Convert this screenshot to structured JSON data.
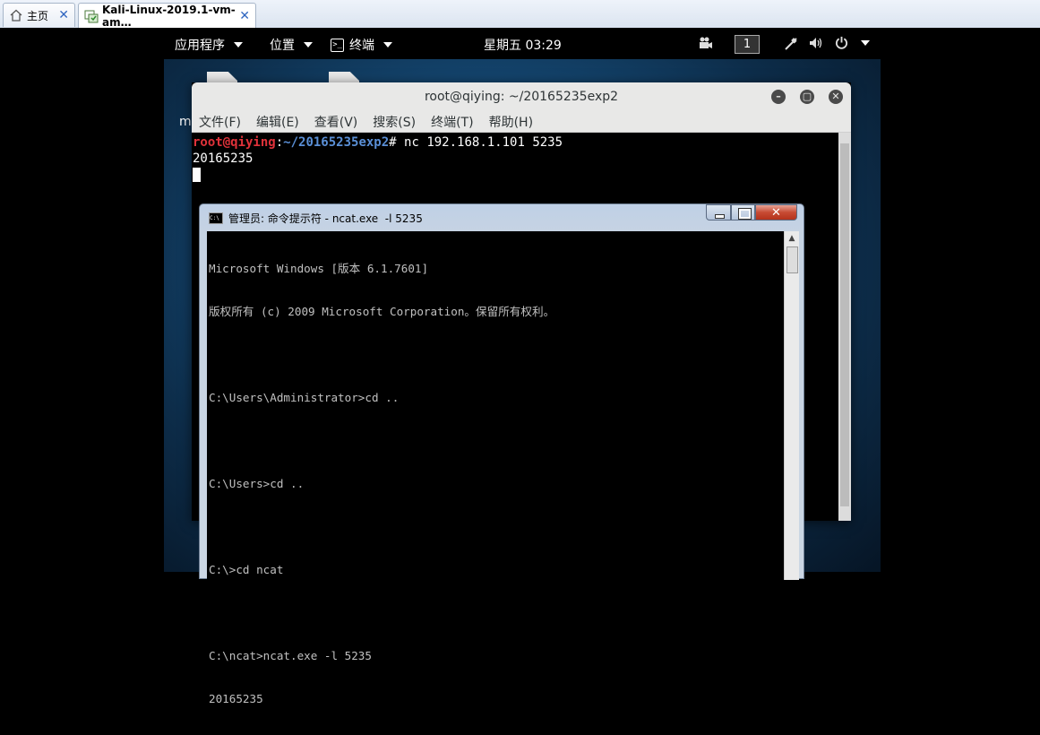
{
  "tabs": [
    {
      "label": "主页",
      "icon": "home-icon"
    },
    {
      "label": "Kali-Linux-2019.1-vm-am…",
      "icon": "vm-icon"
    }
  ],
  "gnome_bar": {
    "apps_label": "应用程序",
    "places_label": "位置",
    "terminal_label": "终端",
    "clock": "星期五 03:29",
    "workspace": "1"
  },
  "desktop": {
    "partial_label": "m"
  },
  "terminal": {
    "title": "root@qiying: ~/20165235exp2",
    "menu": [
      "文件(F)",
      "编辑(E)",
      "查看(V)",
      "搜索(S)",
      "终端(T)",
      "帮助(H)"
    ],
    "prompt_user": "root@qiying",
    "prompt_sep": ":",
    "prompt_path": "~/20165235exp2",
    "prompt_hash": "#",
    "command": " nc 192.168.1.101 5235",
    "output": "20165235"
  },
  "cmd": {
    "title": "管理员: 命令提示符 - ncat.exe  -l 5235",
    "icon_text": "C:\\",
    "lines": [
      "Microsoft Windows [版本 6.1.7601]",
      "版权所有 (c) 2009 Microsoft Corporation。保留所有权利。",
      "",
      "C:\\Users\\Administrator>cd ..",
      "",
      "C:\\Users>cd ..",
      "",
      "C:\\>cd ncat",
      "",
      "C:\\ncat>ncat.exe -l 5235",
      "20165235"
    ]
  }
}
